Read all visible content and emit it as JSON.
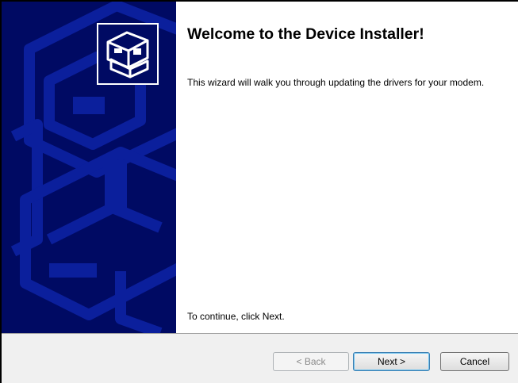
{
  "window": {
    "title": "Welcome to the Device Installer!",
    "description": "This wizard will walk you through updating the drivers for your modem.",
    "continue_text": "To continue, click Next."
  },
  "icons": {
    "banner_art": "computer-hardware-illustration",
    "wizard_icon": "device-installer-box-icon"
  },
  "buttons": {
    "back": "< Back",
    "next": "Next >",
    "cancel": "Cancel"
  },
  "colors": {
    "banner": "#000a63",
    "banner_art": "#0b1f9c",
    "footer": "#f0f0f0"
  }
}
